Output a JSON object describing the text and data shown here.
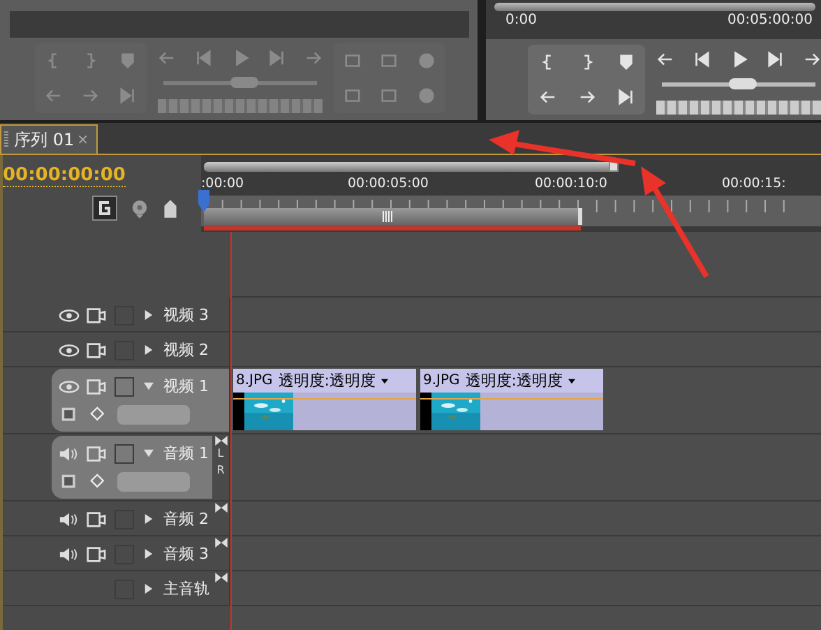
{
  "monitors": [
    {
      "disabled": true
    },
    {
      "disabled": false,
      "ruler": [
        "0:00",
        "00:05:00:00"
      ]
    }
  ],
  "tab": {
    "title": "序列 01",
    "close": "×",
    "selected": true
  },
  "timecode": "00:00:00:00",
  "ruler": [
    ":00:00",
    "00:00:05:00",
    "00:00:10:0",
    "00:00:15:"
  ],
  "tracks": [
    {
      "kind": "video",
      "name": "视频 3",
      "expanded": false
    },
    {
      "kind": "video",
      "name": "视频 2",
      "expanded": false
    },
    {
      "kind": "video",
      "name": "视频 1",
      "expanded": true,
      "clips": [
        {
          "name": "8.JPG",
          "effect": "透明度:透明度"
        },
        {
          "name": "9.JPG",
          "effect": "透明度:透明度"
        }
      ]
    },
    {
      "kind": "audio",
      "name": "音频 1",
      "expanded": true,
      "channels": [
        "L",
        "R"
      ]
    },
    {
      "kind": "audio",
      "name": "音频 2",
      "expanded": false
    },
    {
      "kind": "audio",
      "name": "音频 3",
      "expanded": false
    },
    {
      "kind": "master",
      "name": "主音轨",
      "expanded": false
    }
  ]
}
